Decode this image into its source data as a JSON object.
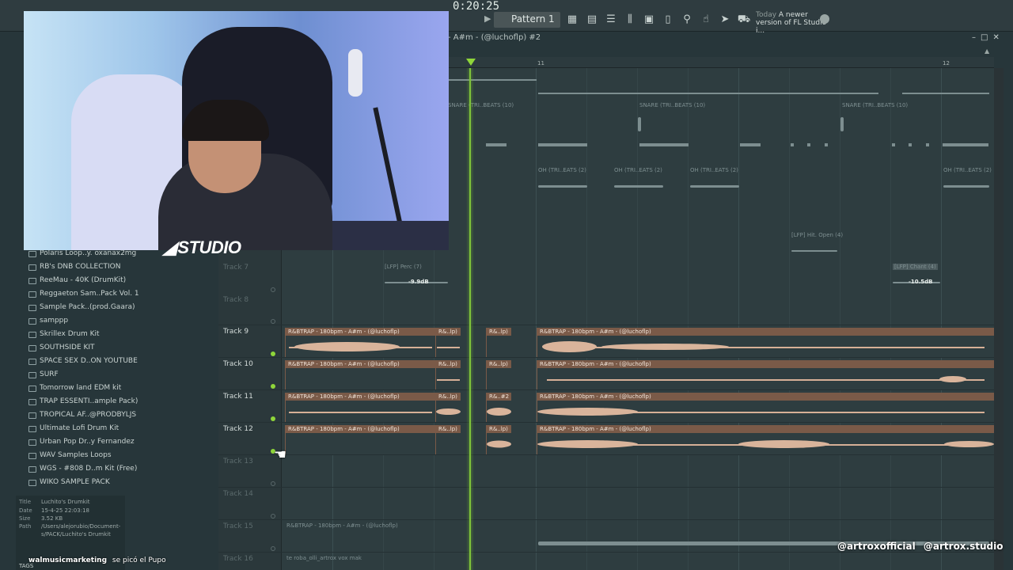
{
  "toolbar": {
    "clock": "0:20:25",
    "pattern_label": "Pattern 1",
    "news_today": "Today",
    "news_text": "A newer version of FL Studio i..."
  },
  "playlist": {
    "title": "- A#m - (@luchoflp) #2",
    "bar_numbers": [
      "11",
      "12"
    ],
    "tracks": [
      {
        "label": "Track 7",
        "dim": true
      },
      {
        "label": "Track 8",
        "dim": true
      },
      {
        "label": "Track 9",
        "dim": false
      },
      {
        "label": "Track 10",
        "dim": false
      },
      {
        "label": "Track 11",
        "dim": false
      },
      {
        "label": "Track 12",
        "dim": false
      },
      {
        "label": "Track 13",
        "dim": true
      },
      {
        "label": "Track 14",
        "dim": true
      },
      {
        "label": "Track 15",
        "dim": true
      },
      {
        "label": "Track 16",
        "dim": true
      }
    ],
    "ghost_labels": {
      "snare_1": "SNARE (TRI..BEATS (10)",
      "snare_2": "SNARE (TRI..BEATS (10)",
      "snare_3": "SNARE (TRI..BEATS (10)",
      "oh_1": "OH (TRI..EATS (2)",
      "oh_2": "OH (TRI..EATS (2)",
      "oh_3": "OH (TRI..EATS (2)",
      "oh_4": "OH (TRI..EATS (2)",
      "hat_open": "[LFP] Hit. Open (4)",
      "perc": "[LFP] Perc (7)",
      "chant": "[LFP] Chant (4)",
      "track15_clip": "R&BTRAP - 180bpm - A#m - (@luchoflp)",
      "track16_clip": "te roba_olli_artrox vox mak"
    },
    "automation_values": {
      "perc": "-9.9dB",
      "chant": "-10.5dB"
    },
    "clip_labels": {
      "main": "R&BTRAP - 180bpm - A#m - (@luchoflp)",
      "short": "R&..lp)",
      "short_11": "R&..#2"
    }
  },
  "browser": {
    "items": [
      "Polaris Loop..y. oxanax2mg",
      "RB's DNB COLLECTION",
      "ReeMau - 40K (DrumKit)",
      "Reggaeton Sam..Pack Vol. 1",
      "Sample Pack..(prod.Gaara)",
      "samppp",
      "Skrillex Drum Kit",
      "SOUTHSIDE KIT",
      "SPACE SEX D..ON YOUTUBE",
      "SURF",
      "Tomorrow land EDM kit",
      "TRAP ESSENTI..ample Pack)",
      "TROPICAL AF..@PRODBYLJS",
      "Ultimate Lofi Drum Kit",
      "Urban Pop Dr..y Fernandez",
      "WAV Samples Loops",
      "WGS - #808 D..m Kit (Free)",
      "WIKO SAMPLE PACK"
    ],
    "info": {
      "title_key": "Title",
      "title_val": "Luchito's Drumkit",
      "date_key": "Date",
      "date_val": "15-4-25 22:03:18",
      "size_key": "Size",
      "size_val": "3.52 KB",
      "path_key": "Path",
      "path_val_1": "/Users/alejorubio/Document-",
      "path_val_2": "s/PACK/Luchito's Drumkit"
    },
    "tags_label": "TAGS"
  },
  "overlay": {
    "studio_logo": "STUDIO",
    "social": "@artroxofficial  @artrox.studio",
    "chat_user": "walmusicmarketing",
    "chat_message": "se picó el Pupo"
  }
}
